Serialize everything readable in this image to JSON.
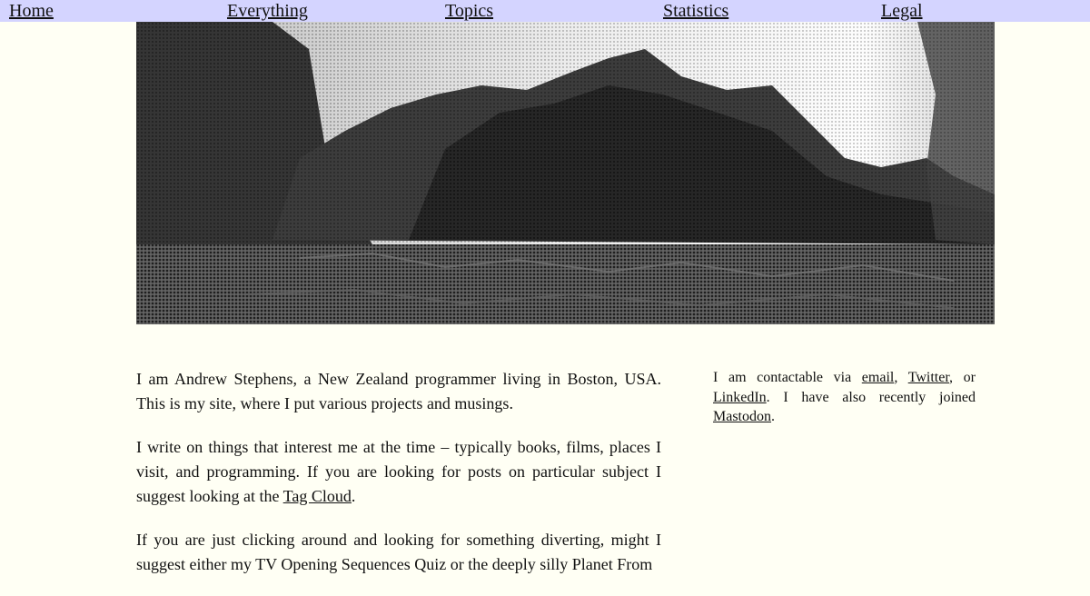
{
  "nav": {
    "items": [
      {
        "label": "Home"
      },
      {
        "label": "Everything"
      },
      {
        "label": "Topics"
      },
      {
        "label": "Statistics"
      },
      {
        "label": "Legal"
      }
    ]
  },
  "hero": {
    "description": "halftone-forest-lake-photo"
  },
  "intro": {
    "p1": "I am Andrew Stephens, a New Zealand programmer living in Boston, USA. This is my site, where I put various projects and musings.",
    "p2_before": "I write on things that interest me at the time – typically books, films, places I visit, and programming. If you are looking for posts on particular subject I suggest looking at the ",
    "p2_link": "Tag Cloud",
    "p2_after": ".",
    "p3": "If you are just clicking around and looking for something diverting, might I suggest either my TV Opening Sequences Quiz or the deeply silly Planet From"
  },
  "contact": {
    "t1": "I am contactable via ",
    "email": "email",
    "t2": ", ",
    "twitter": "Twitter",
    "t3": ", or ",
    "linkedin": "LinkedIn",
    "t4": ". I have also recently joined ",
    "mastodon": "Mastodon",
    "t5": "."
  }
}
